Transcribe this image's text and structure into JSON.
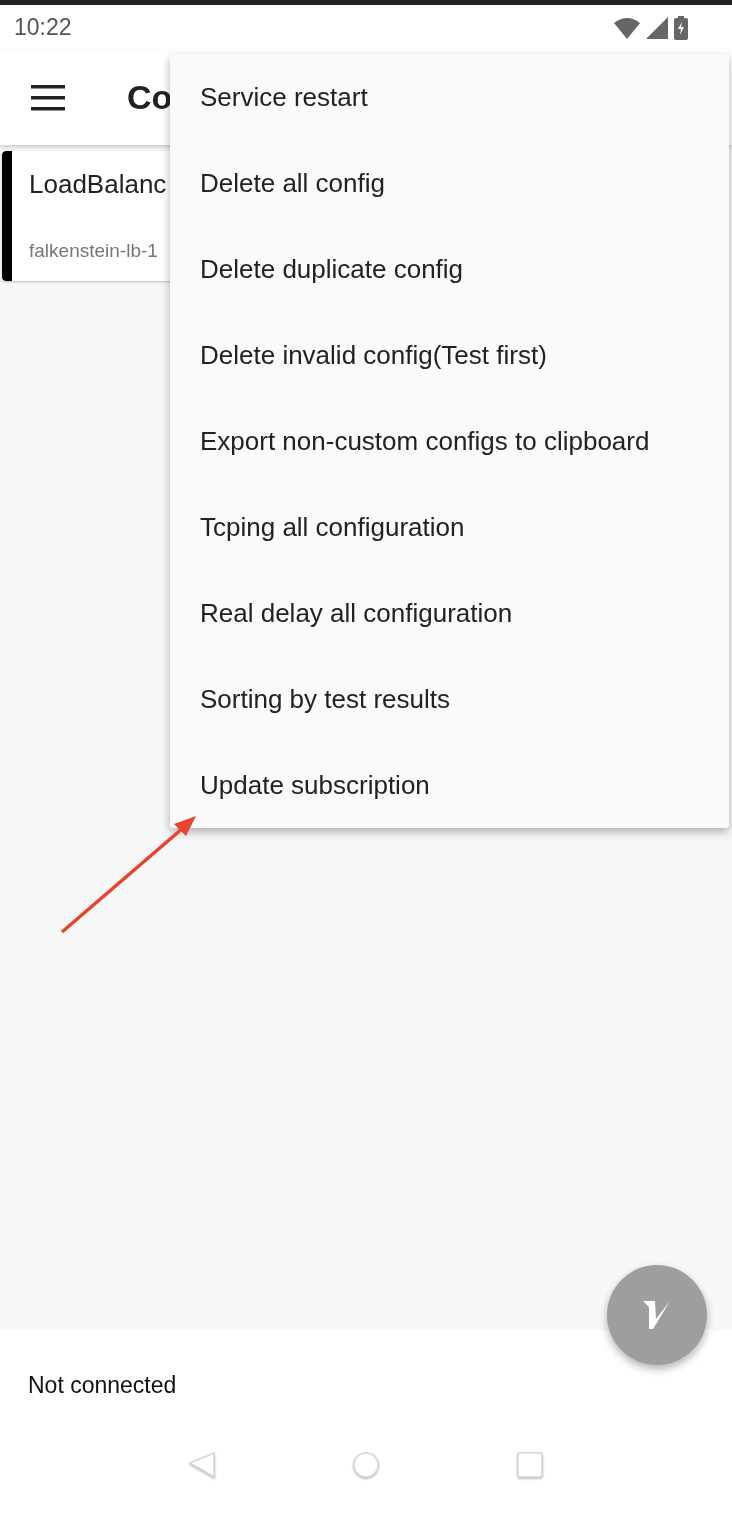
{
  "status_bar": {
    "time": "10:22"
  },
  "app_bar": {
    "title": "Co"
  },
  "configs": [
    {
      "name": "LoadBalanc",
      "address": "falkenstein-lb-1",
      "selected": true
    }
  ],
  "menu": {
    "items": [
      {
        "label": "Service restart"
      },
      {
        "label": "Delete all config"
      },
      {
        "label": "Delete duplicate config"
      },
      {
        "label": "Delete invalid config(Test first)"
      },
      {
        "label": "Export non-custom configs to clipboard"
      },
      {
        "label": "Tcping all configuration"
      },
      {
        "label": "Real delay all configuration"
      },
      {
        "label": "Sorting by test results"
      },
      {
        "label": "Update subscription"
      }
    ]
  },
  "connection_status": "Not connected"
}
